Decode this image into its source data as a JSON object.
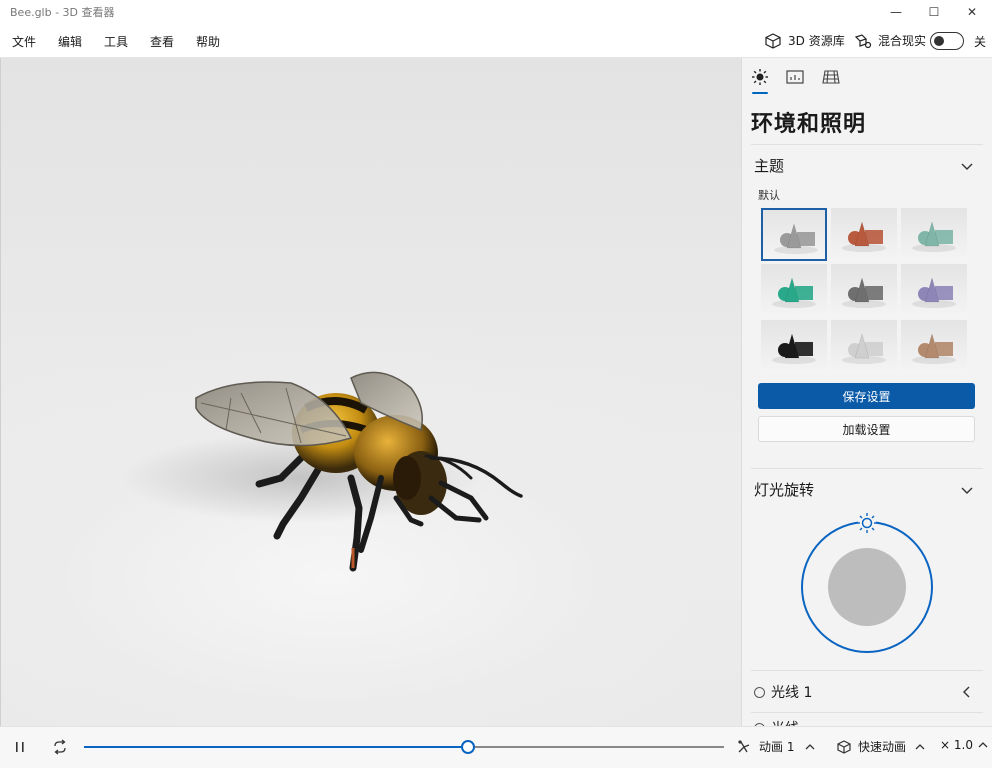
{
  "window": {
    "title": "Bee.glb - 3D 查看器",
    "minimize": "—",
    "maximize": "☐",
    "close": "✕"
  },
  "menu": {
    "items": [
      "文件",
      "编辑",
      "工具",
      "查看",
      "帮助"
    ]
  },
  "toolbar": {
    "library_label": "3D 资源库",
    "mixed_reality_label": "混合现实",
    "toggle_state": "关"
  },
  "panel": {
    "title": "环境和照明",
    "theme": {
      "section": "主题",
      "default_label": "默认",
      "thumbnails": [
        {
          "color": "#9a9a9a",
          "selected": true
        },
        {
          "color": "#b85a3e",
          "selected": false
        },
        {
          "color": "#7fb6a8",
          "selected": false
        },
        {
          "color": "#2aa98a",
          "selected": false
        },
        {
          "color": "#6f6f6f",
          "selected": false
        },
        {
          "color": "#8f86b8",
          "selected": false
        },
        {
          "color": "#1a1a1a",
          "selected": false
        },
        {
          "color": "#cfcfcf",
          "selected": false
        },
        {
          "color": "#b38a6e",
          "selected": false
        }
      ]
    },
    "save_label": "保存设置",
    "load_label": "加载设置",
    "light_rotation": {
      "section": "灯光旋转"
    },
    "light1": {
      "label": "光线 1"
    },
    "light2": {
      "label": "光线"
    }
  },
  "playback": {
    "progress": 0.6,
    "animation_label": "动画 1",
    "quick_animation_label": "快速动画",
    "speed_label": "× 1.0"
  },
  "colors": {
    "accent": "#0b5aa8",
    "ring": "#0a64c2"
  }
}
